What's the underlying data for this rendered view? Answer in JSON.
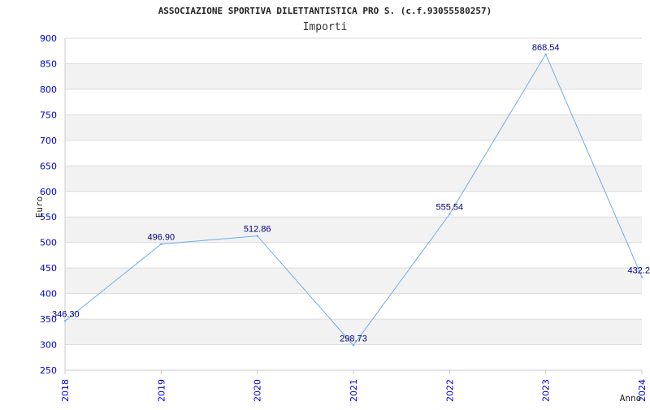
{
  "chart_data": {
    "type": "line",
    "title": "ASSOCIAZIONE SPORTIVA DILETTANTISTICA PRO S. (c.f.93055580257)",
    "subtitle": "Importi",
    "xlabel": "Anno",
    "ylabel": "Euro",
    "categories": [
      "2018",
      "2019",
      "2020",
      "2021",
      "2022",
      "2023",
      "2024"
    ],
    "series": [
      {
        "values": [
          346.3,
          496.9,
          512.86,
          298.73,
          555.54,
          868.54,
          432.2
        ],
        "labels": [
          "346.30",
          "496.90",
          "512.86",
          "298.73",
          "555.54",
          "868.54",
          "432.2"
        ]
      }
    ],
    "ylim": [
      250,
      900
    ],
    "yticks": [
      "900",
      "850",
      "800",
      "750",
      "700",
      "650",
      "600",
      "550",
      "500",
      "450",
      "400",
      "350",
      "300",
      "250"
    ],
    "grid": true,
    "colors": {
      "line": "#6aaee8",
      "band": "#f2f2f2",
      "gridline": "#dddddd",
      "tick_text": "#0000cc",
      "data_label": "#000080"
    }
  }
}
